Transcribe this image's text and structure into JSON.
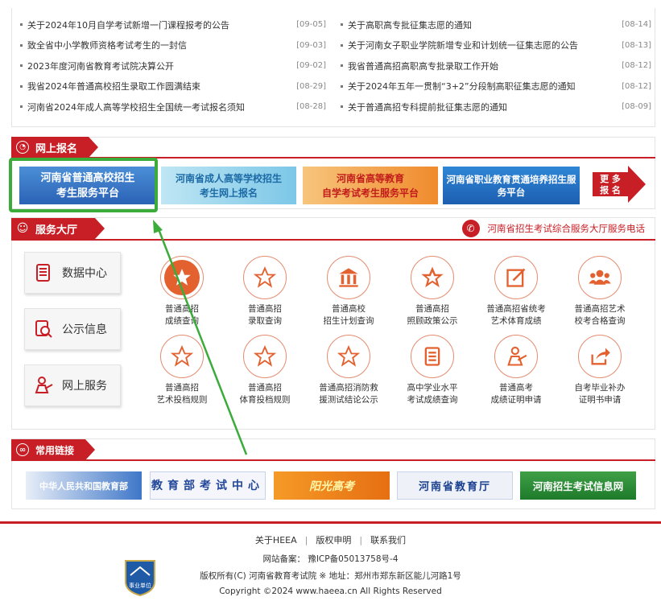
{
  "news": {
    "left": [
      {
        "title": "关于2024年10月自学考试新增一门课程报考的公告",
        "date": "[09-05]"
      },
      {
        "title": "致全省中小学教师资格考试考生的一封信",
        "date": "[09-03]"
      },
      {
        "title": "2023年度河南省教育考试院决算公开",
        "date": "[09-02]"
      },
      {
        "title": "我省2024年普通高校招生录取工作圆满结束",
        "date": "[08-29]"
      },
      {
        "title": "河南省2024年成人高等学校招生全国统一考试报名须知",
        "date": "[08-28]"
      }
    ],
    "right": [
      {
        "title": "关于高职高专批征集志愿的通知",
        "date": "[08-14]"
      },
      {
        "title": "关于河南女子职业学院新增专业和计划统一征集志愿的公告",
        "date": "[08-13]"
      },
      {
        "title": "我省普通高招高职高专批录取工作开始",
        "date": "[08-12]"
      },
      {
        "title": "关于2024年五年一贯制“3+2”分段制高职征集志愿的通知",
        "date": "[08-12]"
      },
      {
        "title": "关于普通高招专科提前批征集志愿的通知",
        "date": "[08-09]"
      }
    ]
  },
  "online_reg": {
    "title": "网上报名",
    "banners": [
      {
        "line1": "河南省普通高校招生",
        "line2": "考生服务平台"
      },
      {
        "line1": "河南省成人高等学校招生",
        "line2": "考生网上报名"
      },
      {
        "line1": "河南省高等教育",
        "line2": "自学考试考生服务平台"
      },
      {
        "line1": "河南省职业教育贯通培养招生服务平台"
      }
    ],
    "more_line1": "更 多",
    "more_line2": "报 名"
  },
  "hall": {
    "title": "服务大厅",
    "phone_label": "河南省招生考试综合服务大厅服务电话",
    "side_buttons": [
      {
        "label": "数据中心",
        "icon": "document-icon"
      },
      {
        "label": "公示信息",
        "icon": "search-doc-icon"
      },
      {
        "label": "网上服务",
        "icon": "person-desk-icon"
      }
    ],
    "services": [
      {
        "line1": "普通高招",
        "line2": "成绩查询",
        "icon": "star-filled-icon"
      },
      {
        "line1": "普通高招",
        "line2": "录取查询",
        "icon": "star-icon"
      },
      {
        "line1": "普通高校",
        "line2": "招生计划查询",
        "icon": "building-icon"
      },
      {
        "line1": "普通高招",
        "line2": "照顾政策公示",
        "icon": "star-icon"
      },
      {
        "line1": "普通高招省统考",
        "line2": "艺术体育成绩",
        "icon": "edit-icon"
      },
      {
        "line1": "普通高招艺术",
        "line2": "校考合格查询",
        "icon": "group-icon"
      },
      {
        "line1": "普通高招",
        "line2": "艺术投档规则",
        "icon": "star-icon"
      },
      {
        "line1": "普通高招",
        "line2": "体育投档规则",
        "icon": "star-icon"
      },
      {
        "line1": "普通高招消防救",
        "line2": "援测试结论公示",
        "icon": "star-icon"
      },
      {
        "line1": "高中学业水平",
        "line2": "考试成绩查询",
        "icon": "document-icon"
      },
      {
        "line1": "普通高考",
        "line2": "成绩证明申请",
        "icon": "person-desk-icon"
      },
      {
        "line1": "自考毕业补办",
        "line2": "证明书申请",
        "icon": "share-icon"
      }
    ]
  },
  "links": {
    "title": "常用链接",
    "items": [
      "中华人民共和国教育部",
      "教育部考试中心",
      "阳光高考",
      "河南省教育厅",
      "河南招生考试信息网"
    ]
  },
  "footer": {
    "nav": [
      "关于HEEA",
      "版权申明",
      "联系我们"
    ],
    "record": "网站备案：   豫ICP备05013758号-4",
    "copyright_org": "版权所有(C) 河南省教育考试院 ※ 地址：郑州市郑东新区能儿河路1号",
    "copyright": "Copyright ©2024 www.haeea.cn All Rights Reserved",
    "badge_text": "事业单位"
  },
  "colors": {
    "brand_red": "#c71f25",
    "icon_orange": "#e3612f",
    "highlight_green": "#3bab3a"
  }
}
